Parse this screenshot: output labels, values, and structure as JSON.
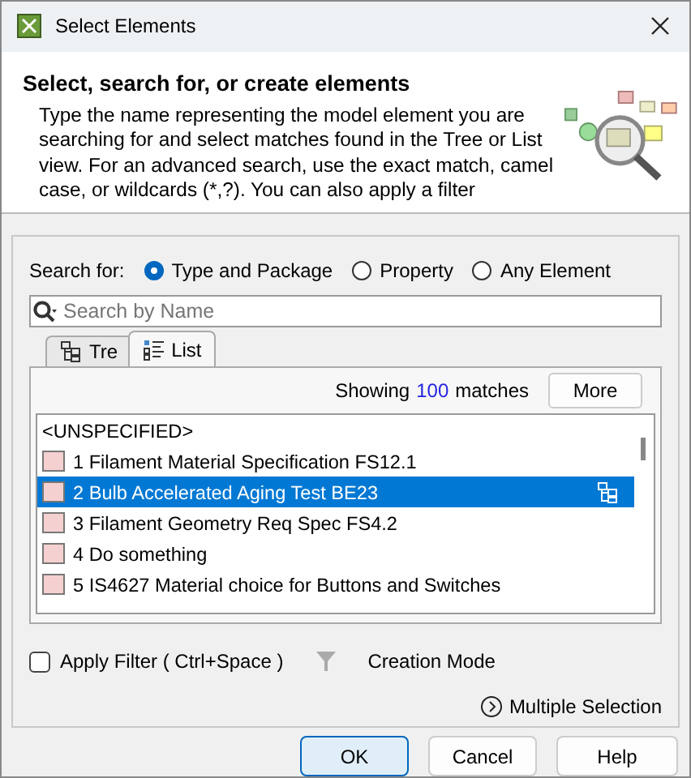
{
  "window": {
    "title": "Select Elements"
  },
  "header": {
    "title": "Select, search for, or create elements",
    "description": "Type the name representing the model element you are searching for and select matches found in the Tree or List view. For an advanced search, use the exact match, camel case, or wildcards (*,?). You can also apply a filter"
  },
  "search_for": {
    "label": "Search for:",
    "options": [
      {
        "label": "Type and Package",
        "selected": true
      },
      {
        "label": "Property",
        "selected": false
      },
      {
        "label": "Any Element",
        "selected": false
      }
    ]
  },
  "search": {
    "placeholder": "Search by Name"
  },
  "tabs": [
    {
      "label": "Tre",
      "selected": false,
      "kind": "tree"
    },
    {
      "label": "List",
      "selected": true,
      "kind": "list"
    }
  ],
  "results": {
    "prefix": "Showing",
    "count": "100",
    "suffix": "matches",
    "more_button": "More"
  },
  "items": [
    {
      "label": "<UNSPECIFIED>",
      "kind": "plain",
      "selected": false
    },
    {
      "label": "1 Filament Material Specification FS12.1",
      "kind": "requirement",
      "selected": false
    },
    {
      "label": "2 Bulb Accelerated Aging Test BE23",
      "kind": "requirement",
      "selected": true
    },
    {
      "label": "3 Filament Geometry Req Spec FS4.2",
      "kind": "requirement",
      "selected": false
    },
    {
      "label": "4 Do something",
      "kind": "requirement",
      "selected": false
    },
    {
      "label": "5 IS4627 Material choice for Buttons and Switches",
      "kind": "requirement",
      "selected": false
    }
  ],
  "filter": {
    "label": "Apply Filter ( Ctrl+Space )",
    "checked": false,
    "creation_mode": "Creation Mode"
  },
  "multiple_selection": "Multiple Selection",
  "buttons": [
    {
      "label": "OK",
      "kind": "default"
    },
    {
      "label": "Cancel",
      "kind": "normal"
    },
    {
      "label": "Help",
      "kind": "normal"
    }
  ]
}
